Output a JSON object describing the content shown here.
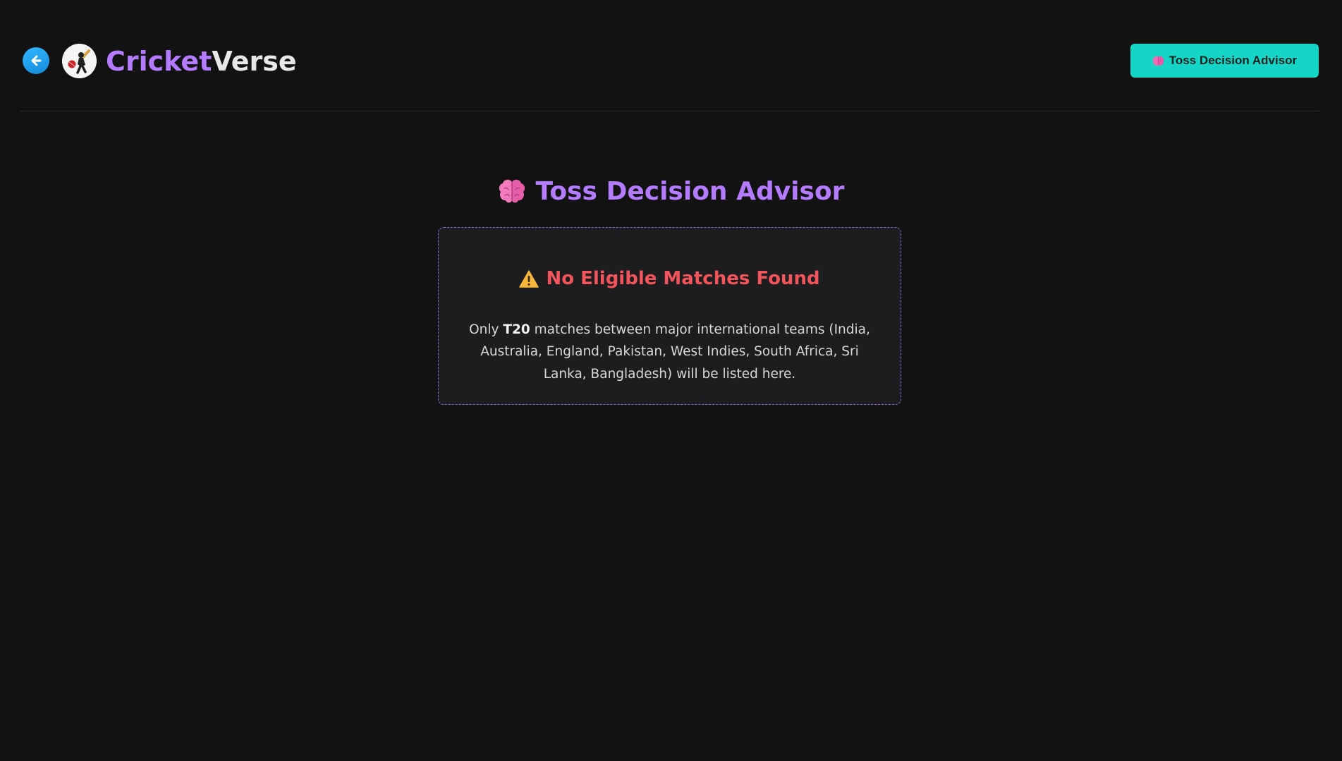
{
  "header": {
    "brand_part1": "Cricket",
    "brand_part2": "Verse",
    "back_icon": "arrow-left-icon",
    "logo_icon": "cricket-batsman-logo",
    "advisor_button_label": "Toss Decision Advisor",
    "advisor_button_icon": "brain-icon"
  },
  "main": {
    "title": "Toss Decision Advisor",
    "title_icon": "brain-icon",
    "card": {
      "warning_icon": "warning-icon",
      "heading": "No Eligible Matches Found",
      "desc_prefix": "Only ",
      "desc_format": "T20",
      "desc_suffix": " matches between major international teams (India, Australia, England, Pakistan, West Indies, South Africa, Sri Lanka, Bangladesh) will be listed here."
    }
  },
  "colors": {
    "background": "#121213",
    "brand_purple": "#b57bff",
    "accent_teal": "#15d6c6",
    "warning_red": "#f2545b",
    "back_button_blue": "#1a9be8",
    "card_border": "#8a62d6"
  }
}
